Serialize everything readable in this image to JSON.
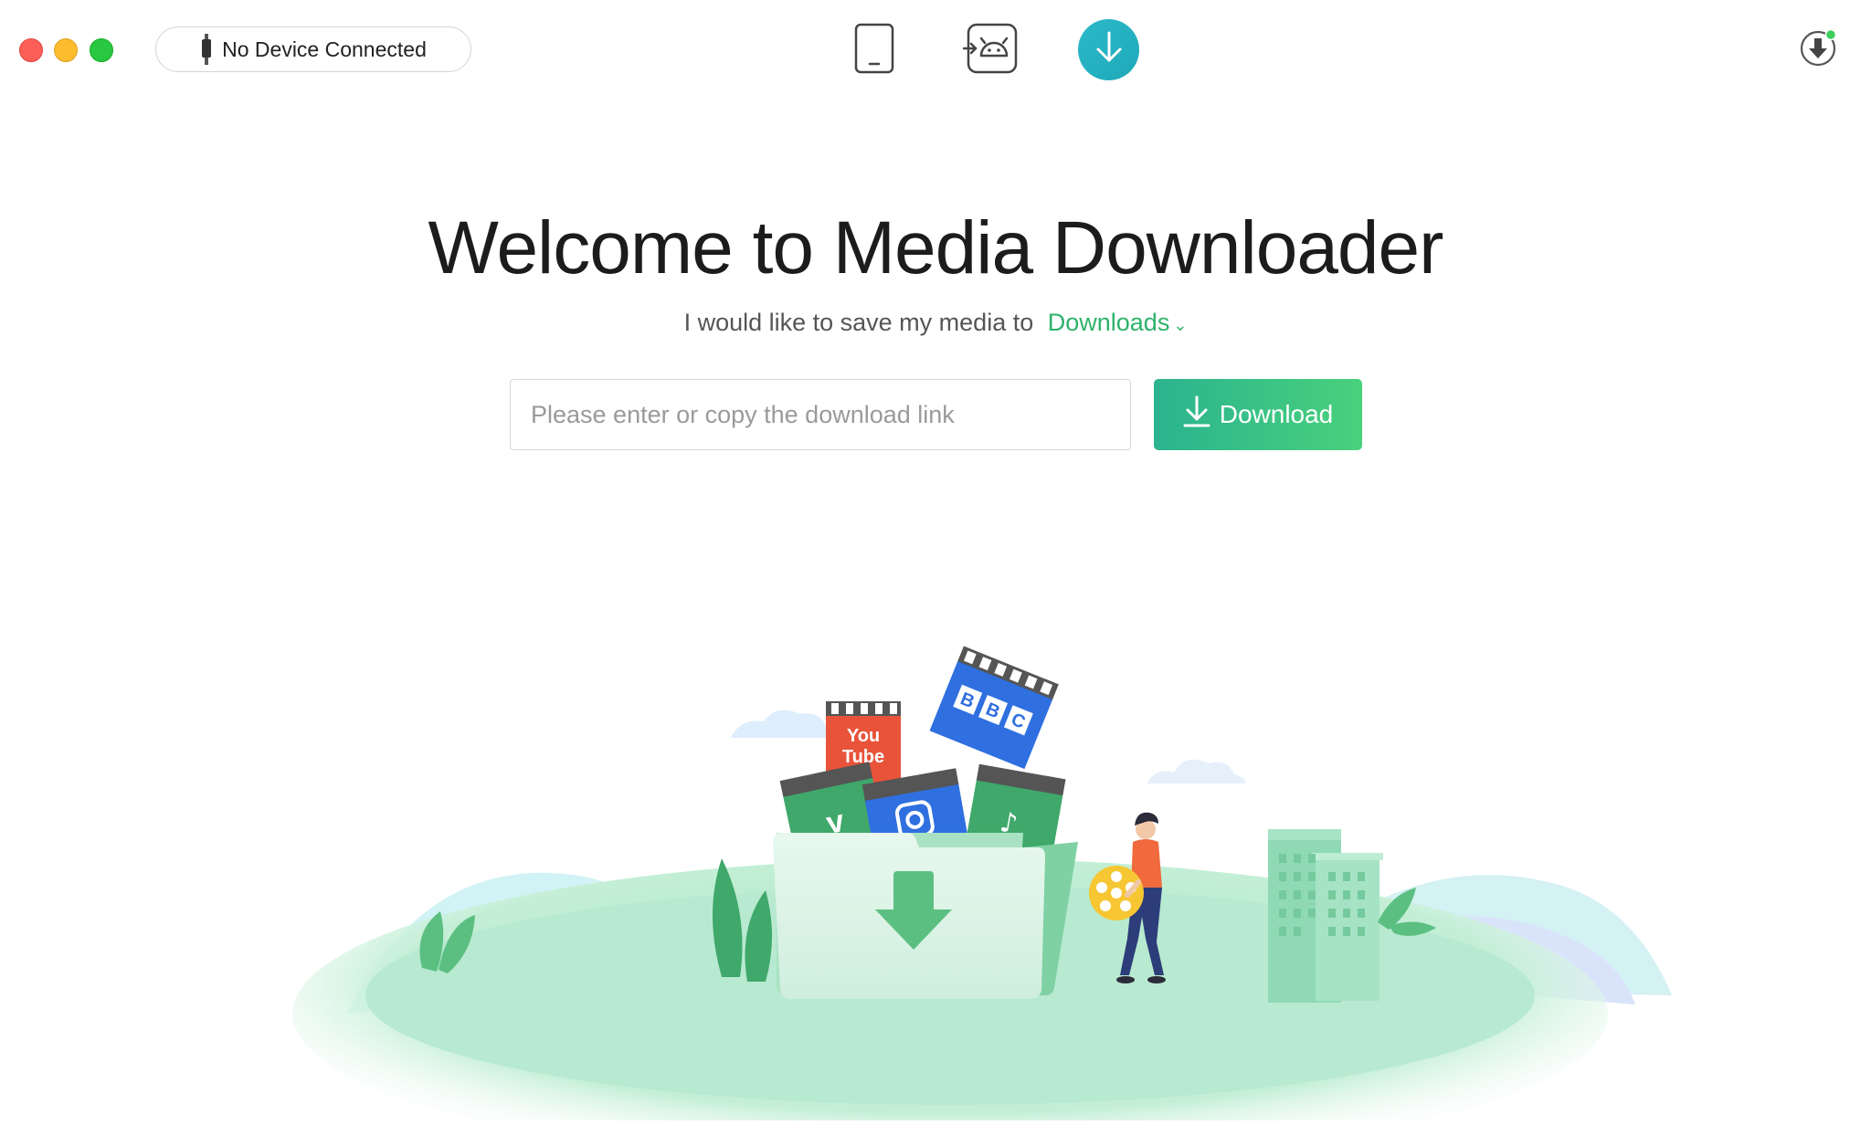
{
  "titlebar": {
    "device_status": "No Device Connected",
    "tools": [
      {
        "name": "phone-manager",
        "icon": "phone-icon"
      },
      {
        "name": "android-mover",
        "icon": "android-transfer-icon"
      },
      {
        "name": "media-downloader",
        "icon": "download-icon",
        "active": true
      },
      {
        "name": "download-queue",
        "icon": "download-queue-icon",
        "badge_color": "#3ccf5a"
      }
    ]
  },
  "main": {
    "title": "Welcome to Media Downloader",
    "save_prefix": "I would like to save my media to",
    "save_destination": "Downloads",
    "link_input": {
      "placeholder": "Please enter or copy the download link",
      "value": ""
    },
    "download_button": "Download"
  },
  "illustration": {
    "clapboards": [
      "You Tube",
      "BBC",
      "vimeo",
      "instagram",
      "music"
    ]
  },
  "colors": {
    "accent_green": "#2db36b",
    "button_gradient_start": "#2bb38f",
    "button_gradient_end": "#49d17c",
    "active_tool": "#1fa9b8"
  }
}
